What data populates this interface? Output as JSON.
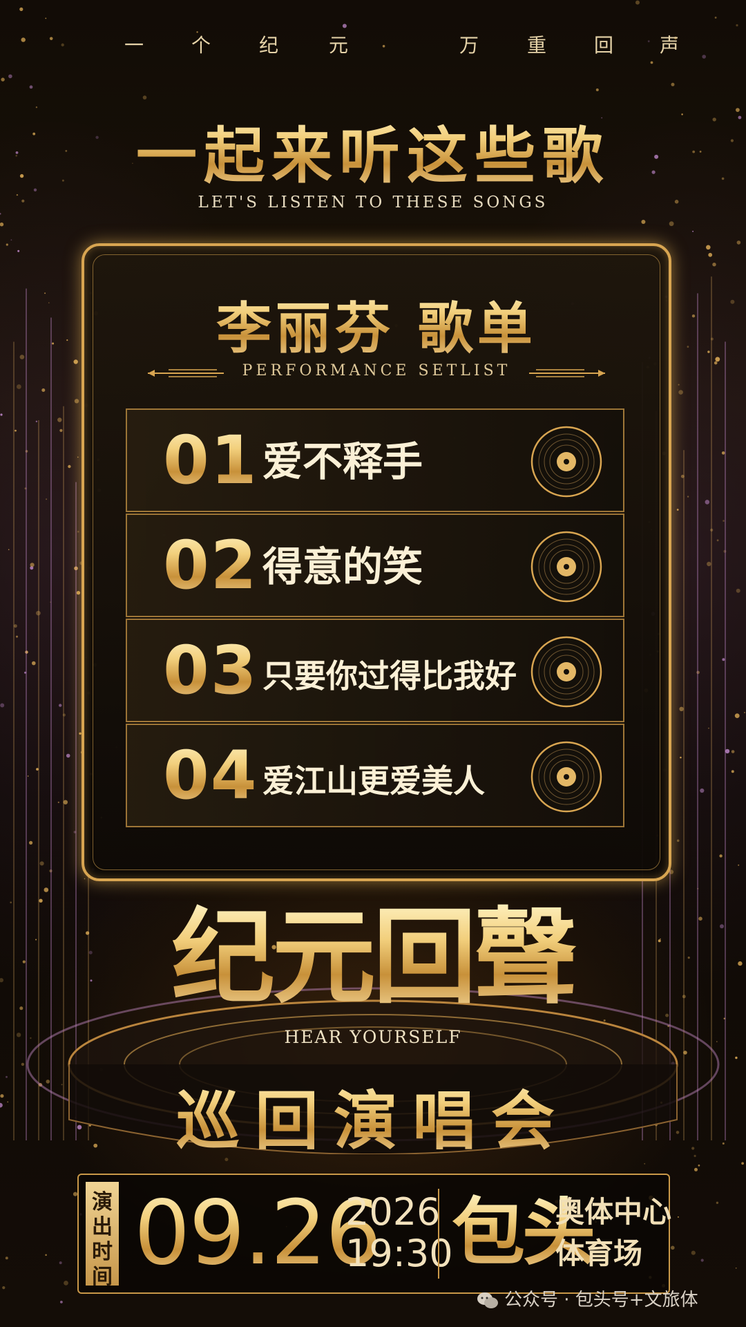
{
  "slogan": [
    "一",
    "个",
    "纪",
    "元",
    "万",
    "重",
    "回",
    "声"
  ],
  "heading": "一起来听这些歌",
  "heading_en": "LET'S LISTEN TO THESE SONGS",
  "setlist": {
    "title": "李丽芬 歌单",
    "subtitle": "PERFORMANCE SETLIST",
    "songs": [
      {
        "num": "01",
        "title": "爱不释手"
      },
      {
        "num": "02",
        "title": "得意的笑"
      },
      {
        "num": "03",
        "title": "只要你过得比我好"
      },
      {
        "num": "04",
        "title": "爱江山更爱美人"
      }
    ]
  },
  "logo": {
    "main": "纪元回聲",
    "sub": "HEAR YOURSELF"
  },
  "tour": "巡回演唱会",
  "info": {
    "label": [
      "演",
      "出",
      "时",
      "间"
    ],
    "date": "09.26",
    "year": "2026",
    "time": "19:30",
    "city": "包头",
    "venue_line1": "奥体中心",
    "venue_line2": "体育场"
  },
  "watermark": "公众号 · 包头号+文旅体",
  "colors": {
    "gold": "#d8a551",
    "background": "#0b0805",
    "text_light": "#fbf0d6"
  }
}
